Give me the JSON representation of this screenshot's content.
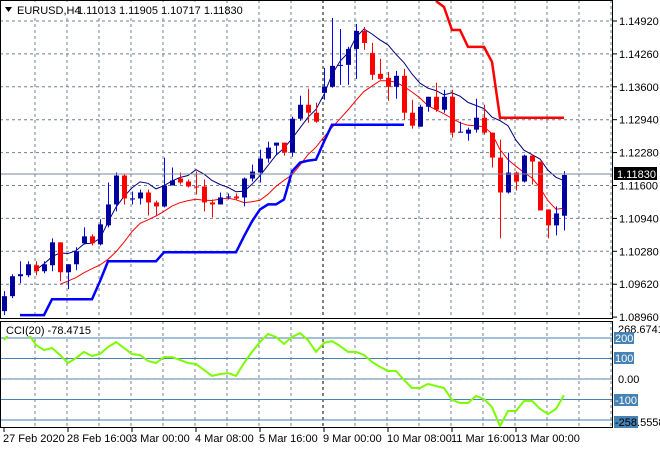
{
  "header": {
    "symbol": "EURUSD,H4",
    "ohlc": "1.11013 1.11905 1.10717 1.11830"
  },
  "price_axis": {
    "ticks": [
      "1.14920",
      "1.14260",
      "1.13600",
      "1.12940",
      "1.12280",
      "1.11600",
      "1.10940",
      "1.10280",
      "1.09620",
      "1.08960"
    ],
    "current_price": "1.11830"
  },
  "cci": {
    "label": "CCI(20) -78.4715",
    "scale_max": "268.6741",
    "scale_min": "-258.5558",
    "levels": [
      "200",
      "100",
      "0.00",
      "-100"
    ],
    "line_color": "#7cfc00"
  },
  "time_axis": {
    "labels": [
      "27 Feb 2020",
      "28 Feb 16:00",
      "3 Mar 00:00",
      "4 Mar 08:00",
      "5 Mar 16:00",
      "9 Mar 00:00",
      "10 Mar 08:00",
      "11 Mar 16:00",
      "13 Mar 00:00"
    ]
  },
  "colors": {
    "bull": "#0000a0",
    "bear": "#ff0000",
    "ma_high": "#000080",
    "ma_low": "#ff0000",
    "support": "#0000ff",
    "resistance": "#ff0000",
    "level": "#4682b4"
  },
  "chart_data": {
    "type": "candlestick",
    "title": "EURUSD,H4",
    "ylim": [
      1.0896,
      1.1525
    ],
    "candles_ohlc": [
      [
        1.091,
        1.095,
        1.0902,
        1.094
      ],
      [
        1.094,
        1.0984,
        1.0936,
        1.098
      ],
      [
        1.098,
        1.101,
        1.0966,
        1.0984
      ],
      [
        1.0982,
        1.101,
        1.0978,
        1.1004
      ],
      [
        1.1002,
        1.101,
        1.0982,
        1.099
      ],
      [
        1.099,
        1.101,
        1.0986,
        1.1004
      ],
      [
        1.1002,
        1.1056,
        1.099,
        1.1048
      ],
      [
        1.1048,
        1.1048,
        1.097,
        1.0988
      ],
      [
        1.0988,
        1.1004,
        1.0954,
        1.1004
      ],
      [
        1.1004,
        1.1038,
        1.0992,
        1.103
      ],
      [
        1.1046,
        1.1078,
        1.1044,
        1.106
      ],
      [
        1.106,
        1.1064,
        1.1042,
        1.1046
      ],
      [
        1.1044,
        1.1094,
        1.1042,
        1.1084
      ],
      [
        1.1082,
        1.1168,
        1.1078,
        1.1124
      ],
      [
        1.1124,
        1.1188,
        1.111,
        1.1182
      ],
      [
        1.1182,
        1.1186,
        1.1124,
        1.1136
      ],
      [
        1.1134,
        1.115,
        1.1124,
        1.1136
      ],
      [
        1.1136,
        1.1154,
        1.1124,
        1.1148
      ],
      [
        1.1148,
        1.1154,
        1.1102,
        1.1128
      ],
      [
        1.1128,
        1.1132,
        1.1102,
        1.112
      ],
      [
        1.112,
        1.1218,
        1.1118,
        1.1162
      ],
      [
        1.1162,
        1.1198,
        1.1162,
        1.1172
      ],
      [
        1.1176,
        1.1188,
        1.1164,
        1.1168
      ],
      [
        1.117,
        1.1174,
        1.1158,
        1.116
      ],
      [
        1.116,
        1.119,
        1.1144,
        1.1158
      ],
      [
        1.116,
        1.1174,
        1.111,
        1.1128
      ],
      [
        1.1128,
        1.1134,
        1.1098,
        1.1124
      ],
      [
        1.1124,
        1.1148,
        1.1124,
        1.1138
      ],
      [
        1.1138,
        1.1146,
        1.1134,
        1.114
      ],
      [
        1.114,
        1.1146,
        1.1134,
        1.1136
      ],
      [
        1.1138,
        1.1178,
        1.112,
        1.1176
      ],
      [
        1.1176,
        1.1204,
        1.117,
        1.119
      ],
      [
        1.1188,
        1.1234,
        1.1168,
        1.1216
      ],
      [
        1.1216,
        1.125,
        1.1208,
        1.1238
      ],
      [
        1.1242,
        1.1248,
        1.1224,
        1.1248
      ],
      [
        1.1248,
        1.1248,
        1.1222,
        1.1228
      ],
      [
        1.1228,
        1.13,
        1.122,
        1.1296
      ],
      [
        1.1296,
        1.1342,
        1.1292,
        1.1324
      ],
      [
        1.1324,
        1.1356,
        1.1288,
        1.1308
      ],
      [
        1.1308,
        1.1328,
        1.1288,
        1.129
      ],
      [
        1.1348,
        1.1398,
        1.1334,
        1.136
      ],
      [
        1.136,
        1.1498,
        1.1358,
        1.1402
      ],
      [
        1.1402,
        1.1476,
        1.1364,
        1.1404
      ],
      [
        1.1404,
        1.144,
        1.1364,
        1.1436
      ],
      [
        1.1436,
        1.1486,
        1.1376,
        1.1472
      ],
      [
        1.1472,
        1.148,
        1.1434,
        1.1448
      ],
      [
        1.1428,
        1.1448,
        1.1374,
        1.1384
      ],
      [
        1.1386,
        1.1416,
        1.1374,
        1.1376
      ],
      [
        1.1378,
        1.139,
        1.1332,
        1.136
      ],
      [
        1.136,
        1.1392,
        1.1336,
        1.1382
      ],
      [
        1.1382,
        1.1396,
        1.1294,
        1.1308
      ],
      [
        1.1308,
        1.1334,
        1.1276,
        1.1282
      ],
      [
        1.128,
        1.1324,
        1.128,
        1.132
      ],
      [
        1.132,
        1.134,
        1.131,
        1.134
      ],
      [
        1.134,
        1.1368,
        1.131,
        1.1314
      ],
      [
        1.1314,
        1.1354,
        1.1308,
        1.134
      ],
      [
        1.134,
        1.1354,
        1.1258,
        1.1268
      ],
      [
        1.1268,
        1.129,
        1.1268,
        1.127
      ],
      [
        1.1266,
        1.1278,
        1.1252,
        1.1274
      ],
      [
        1.1274,
        1.1336,
        1.1268,
        1.1298
      ],
      [
        1.1298,
        1.1324,
        1.1264,
        1.1268
      ],
      [
        1.1268,
        1.1268,
        1.1198,
        1.1218
      ],
      [
        1.1218,
        1.1254,
        1.1056,
        1.1148
      ],
      [
        1.1148,
        1.1228,
        1.1146,
        1.1188
      ],
      [
        1.1188,
        1.119,
        1.1152,
        1.117
      ],
      [
        1.117,
        1.1224,
        1.1168,
        1.1222
      ],
      [
        1.1222,
        1.1224,
        1.1164,
        1.121
      ],
      [
        1.121,
        1.121,
        1.1112,
        1.1112
      ],
      [
        1.1114,
        1.1114,
        1.1056,
        1.1082
      ],
      [
        1.1082,
        1.112,
        1.1062,
        1.1106
      ],
      [
        1.11013,
        1.11905,
        1.10717,
        1.1183
      ]
    ],
    "support_line": [
      null,
      null,
      1.0902,
      1.0902,
      1.0902,
      1.0902,
      1.0934,
      1.0934,
      1.0934,
      1.0934,
      1.0934,
      1.0934,
      1.097,
      1.101,
      1.101,
      1.101,
      1.101,
      1.101,
      1.101,
      1.101,
      1.1028,
      1.1028,
      1.1028,
      1.1028,
      1.1028,
      1.1028,
      1.1028,
      1.1028,
      1.1028,
      1.1028,
      1.106,
      1.109,
      1.1114,
      1.1124,
      1.1124,
      1.1134,
      1.119,
      1.1208,
      1.1212,
      1.1214,
      1.125,
      1.1284,
      1.1284,
      1.1284,
      1.1284,
      1.1284,
      1.1284,
      1.1284,
      1.1284,
      1.1284,
      1.1284,
      null,
      null,
      null,
      null,
      null,
      null,
      null,
      null,
      null,
      null,
      null,
      null,
      null,
      null,
      null,
      null,
      null,
      null,
      null,
      null
    ],
    "resistance_line": [
      null,
      null,
      null,
      null,
      null,
      null,
      null,
      null,
      null,
      null,
      null,
      null,
      null,
      null,
      null,
      null,
      null,
      null,
      null,
      null,
      null,
      null,
      null,
      null,
      null,
      null,
      null,
      null,
      null,
      null,
      null,
      null,
      null,
      null,
      null,
      null,
      null,
      null,
      null,
      null,
      null,
      null,
      null,
      null,
      null,
      null,
      null,
      null,
      null,
      null,
      null,
      null,
      null,
      null,
      1.1545,
      1.152,
      1.1474,
      1.1474,
      1.144,
      1.144,
      1.144,
      1.141,
      1.1298,
      1.1298,
      1.1298,
      1.1298,
      1.1298,
      1.1298,
      1.1298,
      1.1298,
      1.1298
    ],
    "cci_values": [
      190,
      239,
      239,
      224,
      166,
      141,
      151,
      117,
      78,
      102,
      132,
      112,
      122,
      156,
      180,
      151,
      122,
      117,
      88,
      78,
      107,
      107,
      93,
      78,
      73,
      44,
      15,
      24,
      29,
      15,
      78,
      132,
      180,
      220,
      205,
      171,
      205,
      224,
      190,
      132,
      176,
      185,
      161,
      132,
      132,
      117,
      83,
      59,
      39,
      39,
      -5,
      -44,
      -44,
      -24,
      -34,
      -44,
      -102,
      -117,
      -117,
      -83,
      -98,
      -137,
      -230,
      -156,
      -156,
      -107,
      -107,
      -146,
      -171,
      -146,
      -78.4715
    ],
    "ma_high_period": 5,
    "ma_low_period": 8
  }
}
